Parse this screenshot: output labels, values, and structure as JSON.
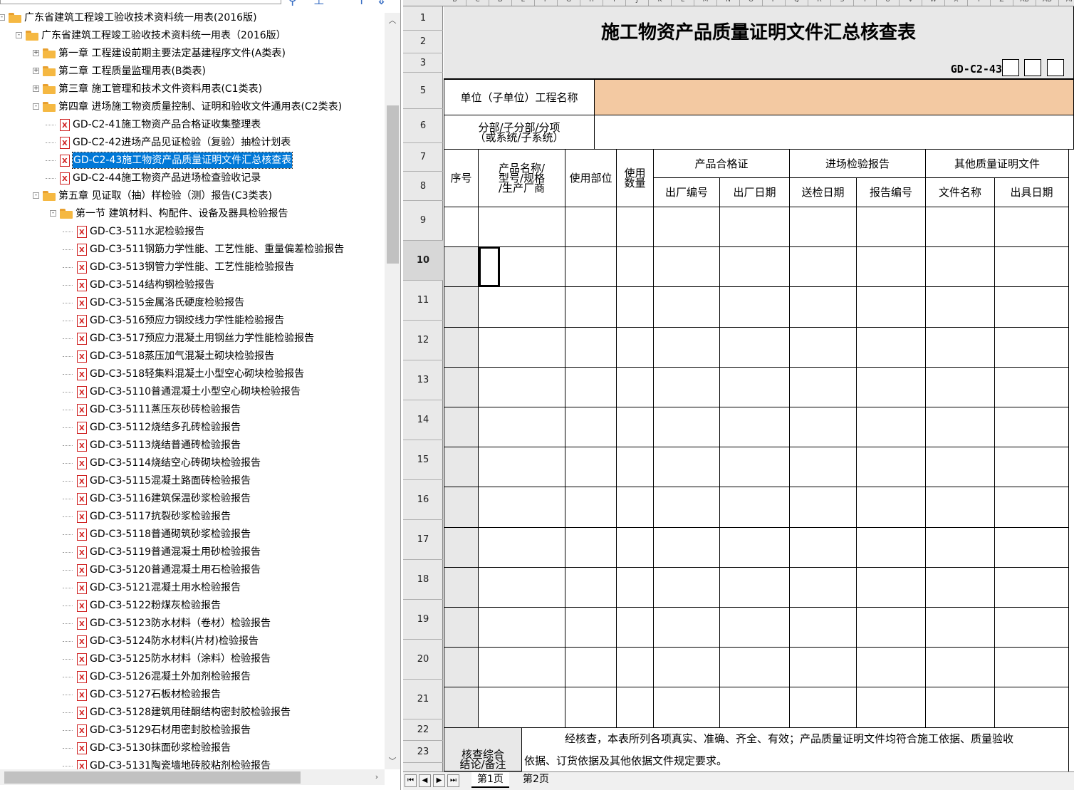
{
  "tree": {
    "nodes": [
      {
        "label": "广东省建筑工程竣工验收技术资料统一用表(2016版)",
        "level": 0,
        "type": "folder",
        "expander": "-"
      },
      {
        "label": "广东省建筑工程竣工验收技术资料统一用表（2016版）",
        "level": 1,
        "type": "folder",
        "expander": "-"
      },
      {
        "label": "第一章 工程建设前期主要法定基建程序文件(A类表)",
        "level": 2,
        "type": "folder",
        "expander": "+"
      },
      {
        "label": "第二章 工程质量监理用表(B类表)",
        "level": 2,
        "type": "folder",
        "expander": "+"
      },
      {
        "label": "第三章 施工管理和技术文件资料用表(C1类表)",
        "level": 2,
        "type": "folder",
        "expander": "+"
      },
      {
        "label": "第四章 进场施工物资质量控制、证明和验收文件通用表(C2类表)",
        "level": 2,
        "type": "folder",
        "expander": "-"
      },
      {
        "label": "GD-C2-41施工物资产品合格证收集整理表",
        "level": 3,
        "type": "file"
      },
      {
        "label": "GD-C2-42进场产品见证检验（复验）抽检计划表",
        "level": 3,
        "type": "file"
      },
      {
        "label": "GD-C2-43施工物资产品质量证明文件汇总核查表",
        "level": 3,
        "type": "file",
        "selected": true
      },
      {
        "label": "GD-C2-44施工物资产品进场检查验收记录",
        "level": 3,
        "type": "file"
      },
      {
        "label": "第五章  见证取（抽）样检验（测）报告(C3类表)",
        "level": 2,
        "type": "folder",
        "expander": "-"
      },
      {
        "label": "第一节 建筑材料、构配件、设备及器具检验报告",
        "level": 3,
        "type": "folder",
        "expander": "-"
      },
      {
        "label": "GD-C3-511水泥检验报告",
        "level": 4,
        "type": "file"
      },
      {
        "label": "GD-C3-511钢筋力学性能、工艺性能、重量偏差检验报告",
        "level": 4,
        "type": "file"
      },
      {
        "label": "GD-C3-513钢管力学性能、工艺性能检验报告",
        "level": 4,
        "type": "file"
      },
      {
        "label": "GD-C3-514结构钢检验报告",
        "level": 4,
        "type": "file"
      },
      {
        "label": "GD-C3-515金属洛氏硬度检验报告",
        "level": 4,
        "type": "file"
      },
      {
        "label": "GD-C3-516预应力钢绞线力学性能检验报告",
        "level": 4,
        "type": "file"
      },
      {
        "label": "GD-C3-517预应力混凝土用钢丝力学性能检验报告",
        "level": 4,
        "type": "file"
      },
      {
        "label": "GD-C3-518蒸压加气混凝土砌块检验报告",
        "level": 4,
        "type": "file"
      },
      {
        "label": "GD-C3-518轻集料混凝土小型空心砌块检验报告",
        "level": 4,
        "type": "file"
      },
      {
        "label": "GD-C3-5110普通混凝土小型空心砌块检验报告",
        "level": 4,
        "type": "file"
      },
      {
        "label": "GD-C3-5111蒸压灰砂砖检验报告",
        "level": 4,
        "type": "file"
      },
      {
        "label": "GD-C3-5112烧结多孔砖检验报告",
        "level": 4,
        "type": "file"
      },
      {
        "label": "GD-C3-5113烧结普通砖检验报告",
        "level": 4,
        "type": "file"
      },
      {
        "label": "GD-C3-5114烧结空心砖砌块检验报告",
        "level": 4,
        "type": "file"
      },
      {
        "label": "GD-C3-5115混凝土路面砖检验报告",
        "level": 4,
        "type": "file"
      },
      {
        "label": "GD-C3-5116建筑保温砂浆检验报告",
        "level": 4,
        "type": "file"
      },
      {
        "label": "GD-C3-5117抗裂砂浆检验报告",
        "level": 4,
        "type": "file"
      },
      {
        "label": "GD-C3-5118普通砌筑砂浆检验报告",
        "level": 4,
        "type": "file"
      },
      {
        "label": "GD-C3-5119普通混凝土用砂检验报告",
        "level": 4,
        "type": "file"
      },
      {
        "label": "GD-C3-5120普通混凝土用石检验报告",
        "level": 4,
        "type": "file"
      },
      {
        "label": "GD-C3-5121混凝土用水检验报告",
        "level": 4,
        "type": "file"
      },
      {
        "label": "GD-C3-5122粉煤灰检验报告",
        "level": 4,
        "type": "file"
      },
      {
        "label": "GD-C3-5123防水材料（卷材）检验报告",
        "level": 4,
        "type": "file"
      },
      {
        "label": "GD-C3-5124防水材料(片材)检验报告",
        "level": 4,
        "type": "file"
      },
      {
        "label": "GD-C3-5125防水材料（涂料）检验报告",
        "level": 4,
        "type": "file"
      },
      {
        "label": "GD-C3-5126混凝土外加剂检验报告",
        "level": 4,
        "type": "file"
      },
      {
        "label": "GD-C3-5127石板材检验报告",
        "level": 4,
        "type": "file"
      },
      {
        "label": "GD-C3-5128建筑用硅酮结构密封胶检验报告",
        "level": 4,
        "type": "file"
      },
      {
        "label": "GD-C3-5129石材用密封胶检验报告",
        "level": 4,
        "type": "file"
      },
      {
        "label": "GD-C3-5130抹面砂浆检验报告",
        "level": 4,
        "type": "file"
      },
      {
        "label": "GD-C3-5131陶瓷墙地砖胶粘剂检验报告",
        "level": 4,
        "type": "file"
      }
    ],
    "scroll_up_icon": "chevron-up-icon",
    "scroll_down_icon": "chevron-down-icon",
    "scroll_right_icon": "chevron-right-icon"
  },
  "spreadsheet": {
    "column_letters": [
      "B",
      "C",
      "D",
      "E",
      "F",
      "G",
      "H",
      "I",
      "J",
      "K",
      "L",
      "M",
      "N",
      "O",
      "P",
      "Q",
      "R",
      "S",
      "T",
      "U",
      "V",
      "W",
      "X",
      "Y",
      "Z",
      "AB",
      "AD",
      "AF"
    ],
    "row_numbers": [
      "1",
      "2",
      "3",
      "5",
      "6",
      "7",
      "8",
      "9",
      "10",
      "11",
      "12",
      "13",
      "14",
      "15",
      "16",
      "17",
      "18",
      "19",
      "20",
      "21",
      "22",
      "23"
    ],
    "current_row": "10",
    "title": "施工物资产品质量证明文件汇总核查表",
    "form_code": "GD-C2-43",
    "project_name_label": "单位（子单位）工程名称",
    "project_name_value": "",
    "subdivision_label": "分部/子分部/分项\n（或系统/子系统）",
    "subdivision_value": "",
    "headers": {
      "seq": "序号",
      "product": "产品名称/\n型号/规格\n/生产厂商",
      "location": "使用部位",
      "quantity": "使用\n数量",
      "certificate": "产品合格证",
      "inspection": "进场检验报告",
      "other": "其他质量证明文件",
      "cert_no": "出厂编号",
      "cert_date": "出厂日期",
      "insp_date": "送检日期",
      "report_no": "报告编号",
      "doc_name": "文件名称",
      "issue_date": "出具日期"
    },
    "conclusion_label": "核查综合\n结论/备注",
    "conclusion_line1": "经核查，本表所列各项真实、准确、齐全、有效；产品质量证明文件均符合施工依据、质量验收",
    "conclusion_line2": "依据、订货依据及其他依据文件规定要求。"
  },
  "sheet_tabs": {
    "nav_first": "⏮",
    "nav_prev": "◀",
    "nav_next": "▶",
    "nav_last": "⏭",
    "tabs": [
      "第1页",
      "第2页"
    ],
    "active": "第1页"
  },
  "colors": {
    "selection": "#0078d7",
    "project_name_fill": "#f3c9a2",
    "header_gray": "#e8e8e8"
  }
}
